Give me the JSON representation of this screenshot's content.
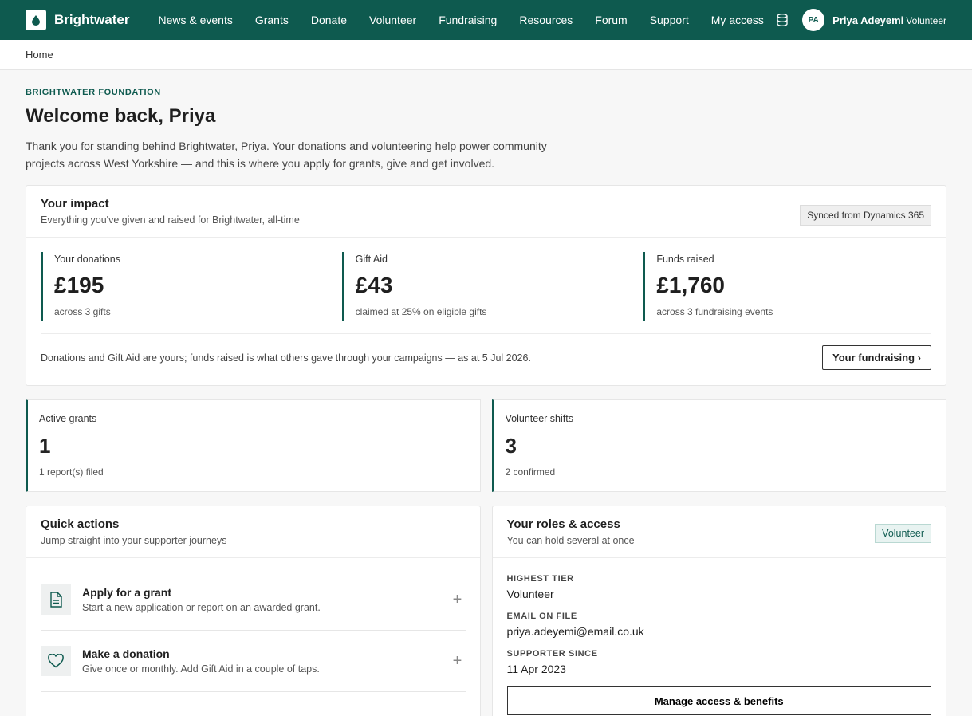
{
  "nav": {
    "brand": "Brightwater",
    "links": [
      "News & events",
      "Grants",
      "Donate",
      "Volunteer",
      "Fundraising",
      "Resources",
      "Forum",
      "Support",
      "My access"
    ],
    "user_initials": "PA",
    "user_name": "Priya Adeyemi",
    "user_role": "Volunteer"
  },
  "breadcrumb": "Home",
  "header": {
    "eyebrow": "BRIGHTWATER FOUNDATION",
    "title": "Welcome back, Priya",
    "intro": "Thank you for standing behind Brightwater, Priya. Your donations and volunteering help power community projects across West Yorkshire — and this is where you apply for grants, give and get involved."
  },
  "impact": {
    "title": "Your impact",
    "subtitle": "Everything you've given and raised for Brightwater, all-time",
    "sync_badge": "Synced from Dynamics 365",
    "stats": [
      {
        "label": "Your donations",
        "value": "£195",
        "note": "across 3 gifts"
      },
      {
        "label": "Gift Aid",
        "value": "£43",
        "note": "claimed at 25% on eligible gifts"
      },
      {
        "label": "Funds raised",
        "value": "£1,760",
        "note": "across 3 fundraising events"
      }
    ],
    "footnote": "Donations and Gift Aid are yours; funds raised is what others gave through your campaigns — as at 5 Jul 2026.",
    "button": "Your fundraising ›"
  },
  "grants": {
    "label": "Active grants",
    "value": "1",
    "note": "1 report(s) filed"
  },
  "shifts": {
    "label": "Volunteer shifts",
    "value": "3",
    "note": "2 confirmed"
  },
  "quick_actions": {
    "title": "Quick actions",
    "subtitle": "Jump straight into your supporter journeys",
    "items": [
      {
        "title": "Apply for a grant",
        "desc": "Start a new application or report on an awarded grant.",
        "icon": "document-icon"
      },
      {
        "title": "Make a donation",
        "desc": "Give once or monthly. Add Gift Aid in a couple of taps.",
        "icon": "heart-icon"
      }
    ]
  },
  "roles": {
    "title": "Your roles & access",
    "subtitle": "You can hold several at once",
    "badge": "Volunteer",
    "fields": [
      {
        "label": "HIGHEST TIER",
        "value": "Volunteer"
      },
      {
        "label": "EMAIL ON FILE",
        "value": "priya.adeyemi@email.co.uk"
      },
      {
        "label": "SUPPORTER SINCE",
        "value": "11 Apr 2023"
      }
    ],
    "button": "Manage access & benefits"
  },
  "colors": {
    "brand": "#0e5a4f",
    "background": "#f7f7f7"
  }
}
